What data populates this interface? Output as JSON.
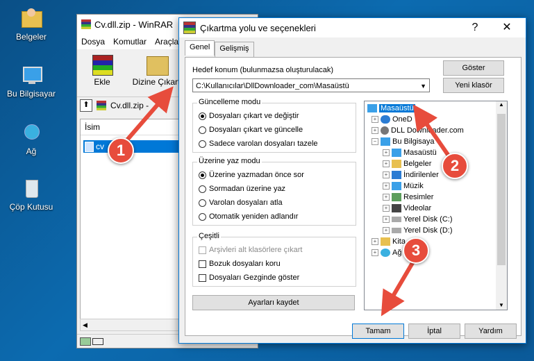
{
  "desktop": {
    "icons": [
      {
        "label": "Belgeler"
      },
      {
        "label": "Bu Bilgisayar"
      },
      {
        "label": "Ağ"
      },
      {
        "label": "Çöp Kutusu"
      }
    ]
  },
  "winrar": {
    "title": "Cv.dll.zip - WinRAR",
    "menu": [
      "Dosya",
      "Komutlar",
      "Araçla"
    ],
    "toolbar": {
      "ekle": "Ekle",
      "dizine_cikart": "Dizine Çıkart"
    },
    "path_label": "Cv.dll.zip -",
    "column_header": "İsim",
    "selected_file": "cv"
  },
  "dialog": {
    "title": "Çıkartma yolu ve seçenekleri",
    "help": "?",
    "close": "✕",
    "tabs": [
      "Genel",
      "Gelişmiş"
    ],
    "hedef_label": "Hedef konum (bulunmazsa oluşturulacak)",
    "hedef_value": "C:\\Kullanıcılar\\DllDownloader_com\\Masaüstü",
    "goster": "Göster",
    "yeni_klasor": "Yeni klasör",
    "guncelleme": {
      "title": "Güncelleme modu",
      "options": [
        "Dosyaları çıkart ve değiştir",
        "Dosyaları çıkart ve güncelle",
        "Sadece varolan dosyaları tazele"
      ]
    },
    "uzerine": {
      "title": "Üzerine yaz modu",
      "options": [
        "Üzerine yazmadan önce sor",
        "Sormadan üzerine yaz",
        "Varolan dosyaları atla",
        "Otomatik yeniden adlandır"
      ]
    },
    "cesitli": {
      "title": "Çeşitli",
      "options": [
        "Arşivleri alt klasörlere çıkart",
        "Bozuk dosyaları koru",
        "Dosyaları Gezginde göster"
      ]
    },
    "ayarlari_kaydet": "Ayarları kaydet",
    "tree": {
      "masaustu": "Masaüstü",
      "onedrive": "OneD",
      "dlldownloader": "DLL Downloader.com",
      "bu_bilgisayar": "Bu Bilgisaya",
      "children": [
        "Masaüstü",
        "Belgeler",
        "İndirilenler",
        "Müzik",
        "Resimler",
        "Videolar",
        "Yerel Disk (C:)",
        "Yerel Disk (D:)"
      ],
      "kitaplik": "Kita",
      "ag": "Ağ"
    },
    "buttons": {
      "tamam": "Tamam",
      "iptal": "İptal",
      "yardim": "Yardım"
    }
  },
  "annotations": [
    "1",
    "2",
    "3"
  ]
}
